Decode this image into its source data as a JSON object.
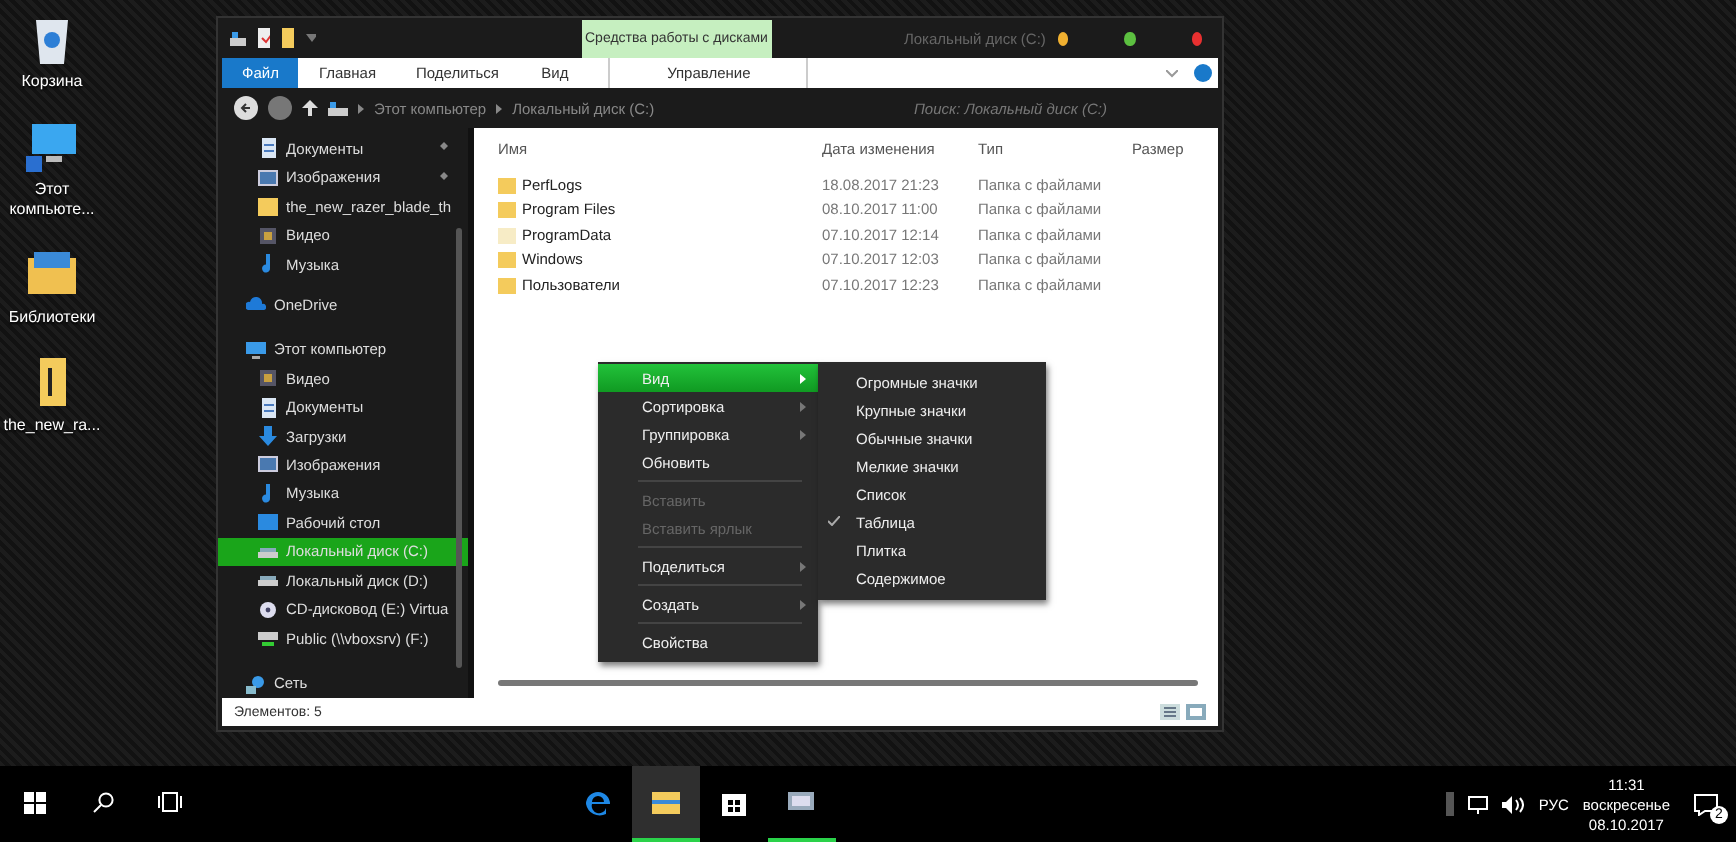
{
  "desktop_icons": [
    {
      "label": "Корзина",
      "kind": "bin"
    },
    {
      "label": "Этот компьюте...",
      "kind": "pc"
    },
    {
      "label": "Библиотеки",
      "kind": "library"
    },
    {
      "label": "the_new_ra...",
      "kind": "file"
    }
  ],
  "window": {
    "title": "Локальный диск (C:)",
    "context_group": {
      "title": "Средства работы с дисками",
      "tab": "Управление"
    },
    "ribbon_tabs": [
      {
        "label": "Файл",
        "selected": true
      },
      {
        "label": "Главная",
        "selected": false
      },
      {
        "label": "Поделиться",
        "selected": false
      },
      {
        "label": "Вид",
        "selected": false
      }
    ],
    "breadcrumbs": [
      "Этот компьютер",
      "Локальный диск (C:)"
    ],
    "search": {
      "placeholder": "Поиск: Локальный диск (C:)"
    },
    "nav": {
      "quick_access": [
        {
          "label": "Документы",
          "kind": "doc",
          "pinned": true,
          "selected": false
        },
        {
          "label": "Изображения",
          "kind": "image",
          "pinned": true,
          "selected": false
        },
        {
          "label": "the_new_razer_blade_th",
          "kind": "folder",
          "pinned": false,
          "selected": false
        },
        {
          "label": "Видео",
          "kind": "video",
          "pinned": false,
          "selected": false
        },
        {
          "label": "Музыка",
          "kind": "music",
          "pinned": false,
          "selected": false
        }
      ],
      "tree": [
        {
          "label": "OneDrive",
          "kind": "cloud",
          "selected": false
        },
        {
          "label": "Этот компьютер",
          "kind": "pc",
          "selected": false,
          "children": [
            {
              "label": "Видео",
              "kind": "video",
              "selected": false
            },
            {
              "label": "Документы",
              "kind": "doc",
              "selected": false
            },
            {
              "label": "Загрузки",
              "kind": "download",
              "selected": false
            },
            {
              "label": "Изображения",
              "kind": "image",
              "selected": false
            },
            {
              "label": "Музыка",
              "kind": "music",
              "selected": false
            },
            {
              "label": "Рабочий стол",
              "kind": "desktop",
              "selected": false
            },
            {
              "label": "Локальный диск (C:)",
              "kind": "drive",
              "selected": true
            },
            {
              "label": "Локальный диск (D:)",
              "kind": "drive",
              "selected": false
            },
            {
              "label": "CD-дисковод (E:) Virtua",
              "kind": "cd",
              "selected": false
            },
            {
              "label": "Public (\\\\vboxsrv) (F:)",
              "kind": "netdrive",
              "selected": false
            }
          ]
        },
        {
          "label": "Сеть",
          "kind": "network",
          "selected": false
        }
      ]
    },
    "columns": [
      "Имя",
      "Дата изменения",
      "Тип",
      "Размер"
    ],
    "rows": [
      {
        "name": "PerfLogs",
        "modified": "18.08.2017 21:23",
        "type": "Папка с файлами",
        "hidden": false
      },
      {
        "name": "Program Files",
        "modified": "08.10.2017 11:00",
        "type": "Папка с файлами",
        "hidden": false
      },
      {
        "name": "ProgramData",
        "modified": "07.10.2017 12:14",
        "type": "Папка с файлами",
        "hidden": true
      },
      {
        "name": "Windows",
        "modified": "07.10.2017 12:03",
        "type": "Папка с файлами",
        "hidden": false
      },
      {
        "name": "Пользователи",
        "modified": "07.10.2017 12:23",
        "type": "Папка с файлами",
        "hidden": false
      }
    ],
    "status_bar": {
      "items_count": "Элементов: 5"
    },
    "context_menu": {
      "items": [
        {
          "kind": "item",
          "label": "Вид",
          "submenu": true,
          "selected": true,
          "disabled": false
        },
        {
          "kind": "item",
          "label": "Сортировка",
          "submenu": true,
          "selected": false,
          "disabled": false
        },
        {
          "kind": "item",
          "label": "Группировка",
          "submenu": true,
          "selected": false,
          "disabled": false
        },
        {
          "kind": "item",
          "label": "Обновить",
          "submenu": false,
          "selected": false,
          "disabled": false
        },
        {
          "kind": "separator"
        },
        {
          "kind": "item",
          "label": "Вставить",
          "submenu": false,
          "selected": false,
          "disabled": true
        },
        {
          "kind": "item",
          "label": "Вставить ярлык",
          "submenu": false,
          "selected": false,
          "disabled": true
        },
        {
          "kind": "separator"
        },
        {
          "kind": "item",
          "label": "Поделиться",
          "submenu": true,
          "selected": false,
          "disabled": false
        },
        {
          "kind": "separator"
        },
        {
          "kind": "item",
          "label": "Создать",
          "submenu": true,
          "selected": false,
          "disabled": false
        },
        {
          "kind": "separator"
        },
        {
          "kind": "item",
          "label": "Свойства",
          "submenu": false,
          "selected": false,
          "disabled": false
        }
      ],
      "submenu": [
        {
          "label": "Огромные значки",
          "checked": false
        },
        {
          "label": "Крупные значки",
          "checked": false
        },
        {
          "label": "Обычные значки",
          "checked": false
        },
        {
          "label": "Мелкие значки",
          "checked": false
        },
        {
          "label": "Список",
          "checked": false
        },
        {
          "label": "Таблица",
          "checked": true
        },
        {
          "label": "Плитка",
          "checked": false
        },
        {
          "label": "Содержимое",
          "checked": false
        }
      ]
    }
  },
  "taskbar": {
    "apps": [
      {
        "kind": "edge",
        "active": false,
        "running": false
      },
      {
        "kind": "explorer",
        "active": true,
        "running": true
      },
      {
        "kind": "store",
        "active": false,
        "running": false
      },
      {
        "kind": "app",
        "active": false,
        "running": true
      }
    ],
    "lang": "РУС",
    "time": "11:31",
    "day": "воскресенье",
    "date": "08.10.2017",
    "notifications": "2"
  }
}
